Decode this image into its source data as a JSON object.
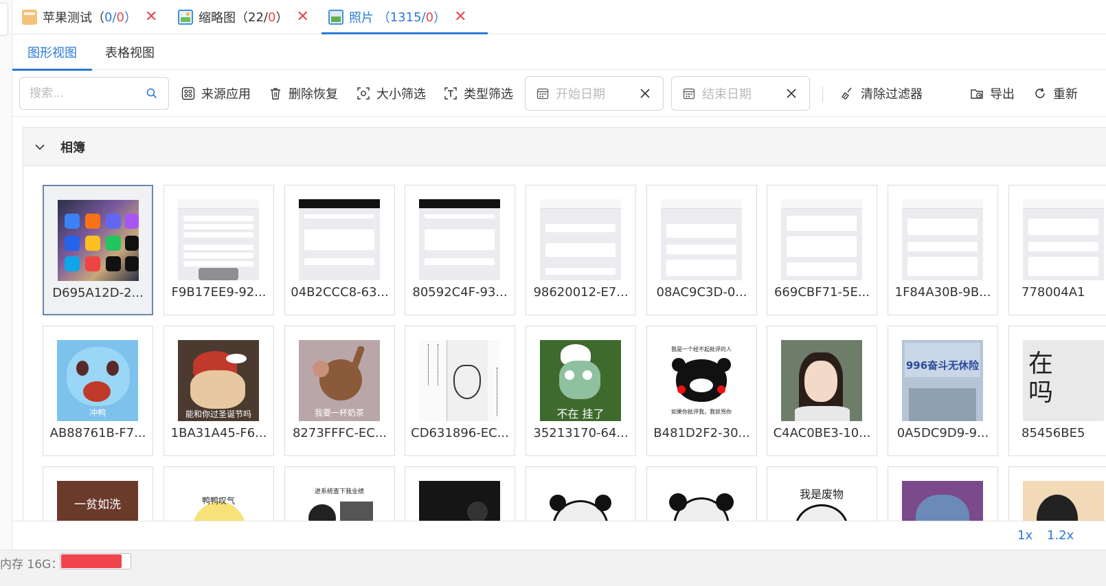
{
  "doc_tabs": [
    {
      "name_text": "苹果测试（",
      "current": "0",
      "slash": "/",
      "red": "0",
      "end": "）",
      "icon": "folder-icon"
    },
    {
      "name_text": "缩略图（",
      "current": "22",
      "slash": "/",
      "red": "0",
      "end": "）",
      "icon": "thumbnail-icon"
    },
    {
      "name_text": "照片 （",
      "current": "1315",
      "slash": "/",
      "red": "0",
      "end": "）",
      "icon": "photo-icon"
    }
  ],
  "view_tabs": {
    "graphic": "图形视图",
    "table": "表格视图"
  },
  "toolbar": {
    "search_placeholder": "搜索...",
    "source_app": "来源应用",
    "delete_recover": "删除恢复",
    "size_filter": "大小筛选",
    "type_filter": "类型筛选",
    "start_date": "开始日期",
    "end_date": "结束日期",
    "clear_filter": "清除过滤器",
    "export": "导出",
    "refresh": "重新"
  },
  "album": {
    "title": "相簿"
  },
  "thumbnails_row1": [
    "D695A12D-2...",
    "F9B17EE9-92...",
    "04B2CCC8-63...",
    "80592C4F-93...",
    "98620012-E7...",
    "08AC9C3D-0...",
    "669CBF71-5E...",
    "1F84A30B-9B...",
    "778004A1"
  ],
  "thumbnails_row2": [
    "AB88761B-F7...",
    "1BA31A45-F6...",
    "8273FFFC-EC...",
    "CD631896-EC...",
    "35213170-64...",
    "B481D2F2-30...",
    "C4AC0BE3-10...",
    "0A5DC9D9-9...",
    "85456BE5"
  ],
  "image_texts": {
    "squirtle": "冲鸭",
    "cat": "能和你过圣诞节吗",
    "jerry": "我要一杯奶茶",
    "squidward": "不在 挂了",
    "kumamon_top": "我是一个经不起批评的人",
    "kumamon_bottom": "如果你批评我，我就骂你",
    "poster": "996奋斗无休险",
    "calligraphy": "在吗",
    "row3_1": "一贫如洗",
    "row3_2": "鸭鸭叹气",
    "row3_3": "进系统查下我业绩",
    "row3_7": "我是废物"
  },
  "zoom": {
    "opt1": "1x",
    "opt2": "1.2x"
  },
  "status": {
    "memory_label": "内存 16G：",
    "memory_usage_fraction": 0.86
  },
  "colors": {
    "accent": "#2979d6",
    "danger": "#e5484d",
    "memory_fill": "#f0444c"
  }
}
